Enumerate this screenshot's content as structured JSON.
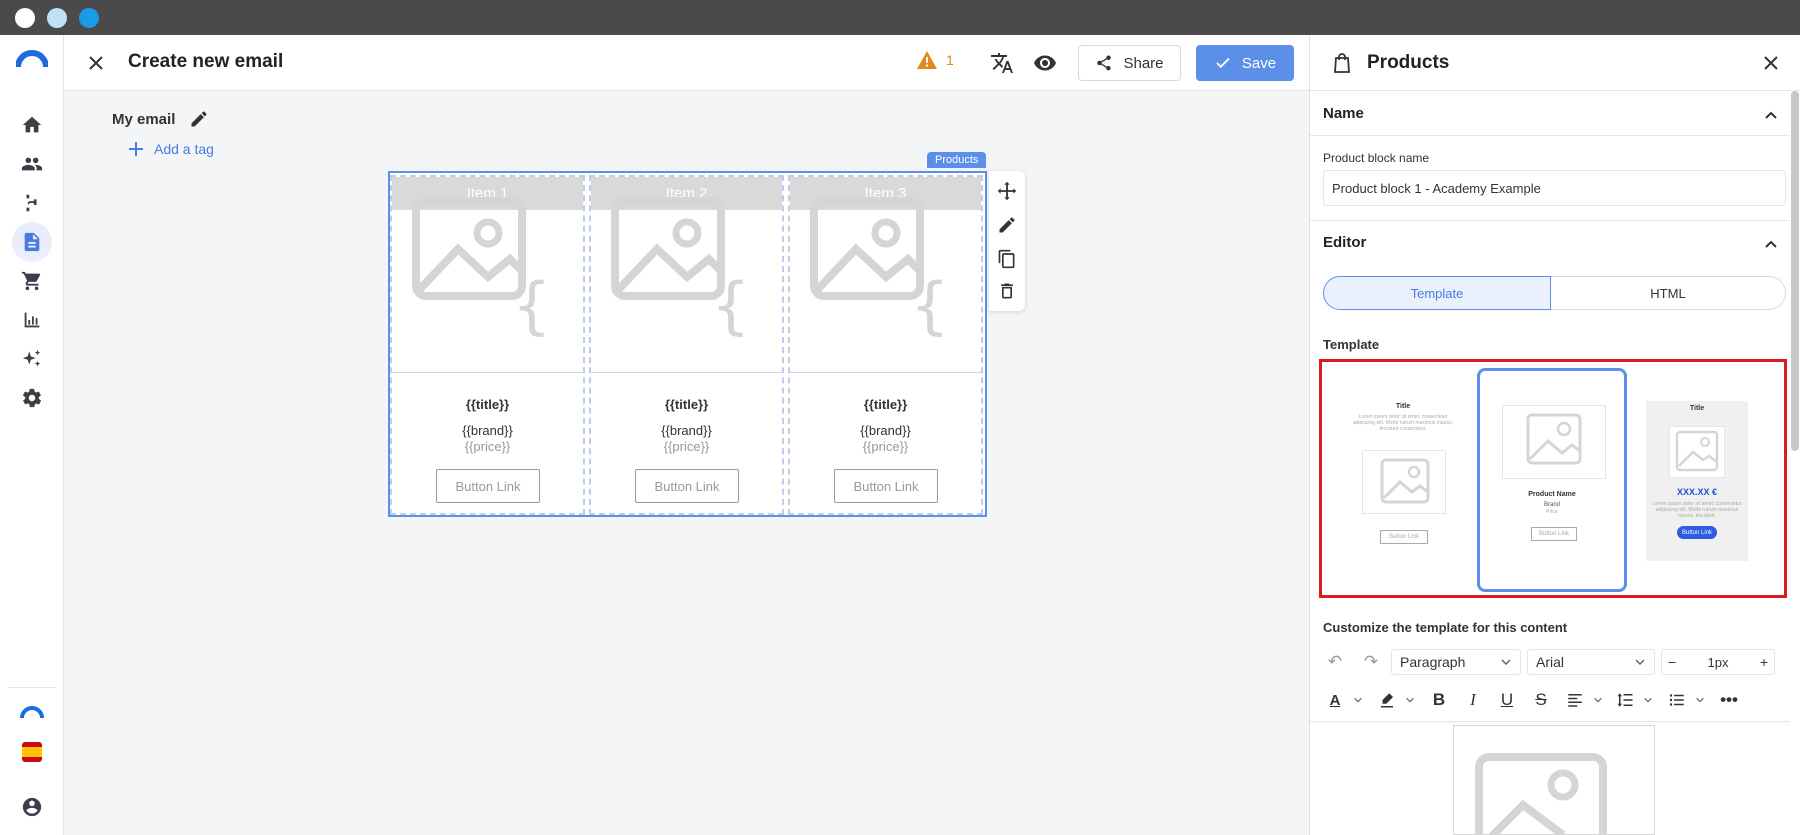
{
  "header": {
    "title": "Create new email",
    "warning_count": "1",
    "share_label": "Share",
    "save_label": "Save"
  },
  "editor": {
    "email_name": "My email",
    "add_tag_label": "Add a tag",
    "block_badge": "Products",
    "items": [
      {
        "header": "Item 1",
        "title": "{{title}}",
        "brand": "{{brand}}",
        "price": "{{price}}",
        "button": "Button Link"
      },
      {
        "header": "Item 2",
        "title": "{{title}}",
        "brand": "{{brand}}",
        "price": "{{price}}",
        "button": "Button Link"
      },
      {
        "header": "Item 3",
        "title": "{{title}}",
        "brand": "{{brand}}",
        "price": "{{price}}",
        "button": "Button Link"
      }
    ]
  },
  "panel": {
    "title": "Products",
    "name_section": "Name",
    "block_name_label": "Product block name",
    "block_name_value": "Product block 1 - Academy Example",
    "editor_section": "Editor",
    "tab_template": "Template",
    "tab_html": "HTML",
    "template_label": "Template",
    "templates": {
      "t1_title": "Title",
      "t1_body": "Lorem ipsum dolor sit amet, consectetur adipiscing elit. Morbi rutrum maximus mauris, tincidunt consectetur.",
      "t1_button": "Button Link",
      "t2_name": "Product Name",
      "t2_brand": "Brand",
      "t2_price": "Price",
      "t2_button": "Button Link",
      "t3_title": "Title",
      "t3_price": "XXX.XX €",
      "t3_body": "Lorem ipsum dolor sit amet, consectetur adipiscing elit. Morbi rutrum maximus mauris, tincidunt.",
      "t3_button": "Button Link"
    },
    "customize_label": "Customize the template for this content",
    "paragraph_select": "Paragraph",
    "font_select": "Arial",
    "font_size": "1px"
  },
  "colors": {
    "accent": "#5b8fe8",
    "warning": "#e08a1e",
    "highlight_frame": "#d91c1c"
  }
}
